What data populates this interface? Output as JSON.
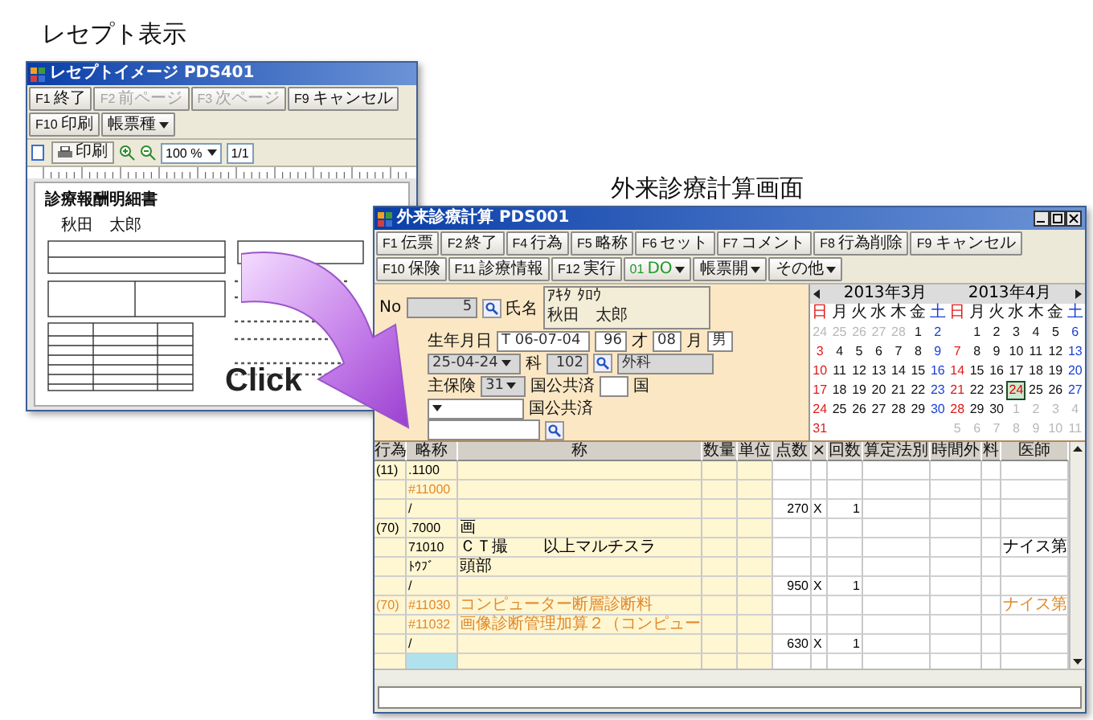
{
  "left_caption": "レセプト表示",
  "right_caption": "外来診療計算画面",
  "receipt_window": {
    "title": "レセプトイメージ PDS401",
    "toolbar": [
      {
        "kind": "fkey",
        "key": "F1",
        "label": "終了",
        "disabled": false
      },
      {
        "kind": "fkey",
        "key": "F2",
        "label": "前ページ",
        "disabled": true
      },
      {
        "kind": "fkey",
        "key": "F3",
        "label": "次ページ",
        "disabled": true
      },
      {
        "kind": "fkey",
        "key": "F9",
        "label": "キャンセル",
        "disabled": false
      },
      {
        "kind": "fkey",
        "key": "F10",
        "label": "印刷",
        "disabled": false
      },
      {
        "kind": "dropdown",
        "label": "帳票種",
        "disabled": false
      }
    ],
    "print_button": "印刷",
    "zoom": "100 %",
    "page": "1/1",
    "document": {
      "title": "診療報酬明細書",
      "patient": "秋田　太郎"
    }
  },
  "click_label": "Click",
  "calc_window": {
    "title": "外来診療計算 PDS001",
    "toolbar": [
      {
        "kind": "fkey",
        "key": "F1",
        "label": "伝票"
      },
      {
        "kind": "fkey",
        "key": "F2",
        "label": "終了"
      },
      {
        "kind": "fkey",
        "key": "F4",
        "label": "行為"
      },
      {
        "kind": "fkey",
        "key": "F5",
        "label": "略称"
      },
      {
        "kind": "fkey",
        "key": "F6",
        "label": "セット"
      },
      {
        "kind": "fkey",
        "key": "F7",
        "label": "コメント"
      },
      {
        "kind": "fkey",
        "key": "F8",
        "label": "行為削除"
      },
      {
        "kind": "fkey",
        "key": "F9",
        "label": "キャンセル"
      },
      {
        "kind": "fkey",
        "key": "F10",
        "label": "保険"
      },
      {
        "kind": "fkey",
        "key": "F11",
        "label": "診療情報"
      },
      {
        "kind": "fkey",
        "key": "F12",
        "label": "実行"
      },
      {
        "kind": "do",
        "key": "01",
        "label": "DO"
      },
      {
        "kind": "dropdown",
        "label": "帳票開"
      },
      {
        "kind": "dropdown",
        "label": "その他"
      }
    ],
    "form": {
      "no_label": "No",
      "no_value": "5",
      "name_label": "氏名",
      "kana": "ｱｷﾀ ﾀﾛｳ",
      "name": "秋田　太郎",
      "birth_label": "生年月日",
      "birth": "T 06-07-04",
      "age": "96",
      "age_unit": "才",
      "months": "08",
      "months_unit": "月",
      "sex": "男",
      "visit_date": "25-04-24",
      "dept_label": "科",
      "dept_code": "102",
      "dept_name": "外科",
      "insurance_label": "主保険",
      "insurance_code": "31",
      "insurance_name": "国公共済",
      "insurance_flag": "国",
      "public_name": "国公共済"
    },
    "calendar": {
      "months": [
        {
          "title": "2013年3月",
          "weekdays": [
            "日",
            "月",
            "火",
            "水",
            "木",
            "金",
            "土"
          ],
          "days": [
            {
              "kind": "day",
              "d": "24",
              "muted": true,
              "selected": false
            },
            {
              "kind": "day",
              "d": "25",
              "muted": true,
              "selected": false
            },
            {
              "kind": "day",
              "d": "26",
              "muted": true,
              "selected": false
            },
            {
              "kind": "day",
              "d": "27",
              "muted": true,
              "selected": false
            },
            {
              "kind": "day",
              "d": "28",
              "muted": true,
              "selected": false
            },
            {
              "kind": "day",
              "d": "1",
              "muted": false,
              "selected": false
            },
            {
              "kind": "day",
              "d": "2",
              "muted": false,
              "selected": false
            },
            {
              "kind": "day",
              "d": "3",
              "muted": false,
              "selected": false
            },
            {
              "kind": "day",
              "d": "4",
              "muted": false,
              "selected": false
            },
            {
              "kind": "day",
              "d": "5",
              "muted": false,
              "selected": false
            },
            {
              "kind": "day",
              "d": "6",
              "muted": false,
              "selected": false
            },
            {
              "kind": "day",
              "d": "7",
              "muted": false,
              "selected": false
            },
            {
              "kind": "day",
              "d": "8",
              "muted": false,
              "selected": false
            },
            {
              "kind": "day",
              "d": "9",
              "muted": false,
              "selected": false
            },
            {
              "kind": "day",
              "d": "10",
              "muted": false,
              "selected": false
            },
            {
              "kind": "day",
              "d": "11",
              "muted": false,
              "selected": false
            },
            {
              "kind": "day",
              "d": "12",
              "muted": false,
              "selected": false
            },
            {
              "kind": "day",
              "d": "13",
              "muted": false,
              "selected": false
            },
            {
              "kind": "day",
              "d": "14",
              "muted": false,
              "selected": false
            },
            {
              "kind": "day",
              "d": "15",
              "muted": false,
              "selected": false
            },
            {
              "kind": "day",
              "d": "16",
              "muted": false,
              "selected": false
            },
            {
              "kind": "day",
              "d": "17",
              "muted": false,
              "selected": false
            },
            {
              "kind": "day",
              "d": "18",
              "muted": false,
              "selected": false
            },
            {
              "kind": "day",
              "d": "19",
              "muted": false,
              "selected": false
            },
            {
              "kind": "day",
              "d": "20",
              "muted": false,
              "selected": false
            },
            {
              "kind": "day",
              "d": "21",
              "muted": false,
              "selected": false
            },
            {
              "kind": "day",
              "d": "22",
              "muted": false,
              "selected": false
            },
            {
              "kind": "day",
              "d": "23",
              "muted": false,
              "selected": false
            },
            {
              "kind": "day",
              "d": "24",
              "muted": false,
              "selected": false
            },
            {
              "kind": "day",
              "d": "25",
              "muted": false,
              "selected": false
            },
            {
              "kind": "day",
              "d": "26",
              "muted": false,
              "selected": false
            },
            {
              "kind": "day",
              "d": "27",
              "muted": false,
              "selected": false
            },
            {
              "kind": "day",
              "d": "28",
              "muted": false,
              "selected": false
            },
            {
              "kind": "day",
              "d": "29",
              "muted": false,
              "selected": false
            },
            {
              "kind": "day",
              "d": "30",
              "muted": false,
              "selected": false
            },
            {
              "kind": "day",
              "d": "31",
              "muted": false,
              "selected": false
            }
          ]
        },
        {
          "title": "2013年4月",
          "weekdays": [
            "日",
            "月",
            "火",
            "水",
            "木",
            "金",
            "土"
          ],
          "days": [
            {
              "kind": "blank"
            },
            {
              "kind": "day",
              "d": "1",
              "muted": false,
              "selected": false
            },
            {
              "kind": "day",
              "d": "2",
              "muted": false,
              "selected": false
            },
            {
              "kind": "day",
              "d": "3",
              "muted": false,
              "selected": false
            },
            {
              "kind": "day",
              "d": "4",
              "muted": false,
              "selected": false
            },
            {
              "kind": "day",
              "d": "5",
              "muted": false,
              "selected": false
            },
            {
              "kind": "day",
              "d": "6",
              "muted": false,
              "selected": false
            },
            {
              "kind": "day",
              "d": "7",
              "muted": false,
              "selected": false
            },
            {
              "kind": "day",
              "d": "8",
              "muted": false,
              "selected": false
            },
            {
              "kind": "day",
              "d": "9",
              "muted": false,
              "selected": false
            },
            {
              "kind": "day",
              "d": "10",
              "muted": false,
              "selected": false
            },
            {
              "kind": "day",
              "d": "11",
              "muted": false,
              "selected": false
            },
            {
              "kind": "day",
              "d": "12",
              "muted": false,
              "selected": false
            },
            {
              "kind": "day",
              "d": "13",
              "muted": false,
              "selected": false
            },
            {
              "kind": "day",
              "d": "14",
              "muted": false,
              "selected": false
            },
            {
              "kind": "day",
              "d": "15",
              "muted": false,
              "selected": false
            },
            {
              "kind": "day",
              "d": "16",
              "muted": false,
              "selected": false
            },
            {
              "kind": "day",
              "d": "17",
              "muted": false,
              "selected": false
            },
            {
              "kind": "day",
              "d": "18",
              "muted": false,
              "selected": false
            },
            {
              "kind": "day",
              "d": "19",
              "muted": false,
              "selected": false
            },
            {
              "kind": "day",
              "d": "20",
              "muted": false,
              "selected": false
            },
            {
              "kind": "day",
              "d": "21",
              "muted": false,
              "selected": false
            },
            {
              "kind": "day",
              "d": "22",
              "muted": false,
              "selected": false
            },
            {
              "kind": "day",
              "d": "23",
              "muted": false,
              "selected": false
            },
            {
              "kind": "day",
              "d": "24",
              "muted": false,
              "selected": true
            },
            {
              "kind": "day",
              "d": "25",
              "muted": false,
              "selected": false
            },
            {
              "kind": "day",
              "d": "26",
              "muted": false,
              "selected": false
            },
            {
              "kind": "day",
              "d": "27",
              "muted": false,
              "selected": false
            },
            {
              "kind": "day",
              "d": "28",
              "muted": false,
              "selected": false
            },
            {
              "kind": "day",
              "d": "29",
              "muted": false,
              "selected": false
            },
            {
              "kind": "day",
              "d": "30",
              "muted": false,
              "selected": false
            },
            {
              "kind": "day",
              "d": "1",
              "muted": true,
              "selected": false
            },
            {
              "kind": "day",
              "d": "2",
              "muted": true,
              "selected": false
            },
            {
              "kind": "day",
              "d": "3",
              "muted": true,
              "selected": false
            },
            {
              "kind": "day",
              "d": "4",
              "muted": true,
              "selected": false
            },
            {
              "kind": "day",
              "d": "5",
              "muted": true,
              "selected": false
            },
            {
              "kind": "day",
              "d": "6",
              "muted": true,
              "selected": false
            },
            {
              "kind": "day",
              "d": "7",
              "muted": true,
              "selected": false
            },
            {
              "kind": "day",
              "d": "8",
              "muted": true,
              "selected": false
            },
            {
              "kind": "day",
              "d": "9",
              "muted": true,
              "selected": false
            },
            {
              "kind": "day",
              "d": "10",
              "muted": true,
              "selected": false
            },
            {
              "kind": "day",
              "d": "11",
              "muted": true,
              "selected": false
            }
          ]
        }
      ]
    },
    "grid": {
      "columns": [
        "行為",
        "略称",
        "称",
        "数量",
        "単位",
        "点数",
        "×",
        "回数",
        "算定法別",
        "時間外",
        "料",
        "医師"
      ],
      "rows": [
        {
          "act": "(11)",
          "abbr": ".1100",
          "color": "#000000",
          "selected": false
        },
        {
          "abbr": "#11000",
          "color": "#e08a2c",
          "selected": false
        },
        {
          "abbr": "/",
          "points": "270",
          "times": "X",
          "count": "1",
          "color": "#000000",
          "selected": false
        },
        {
          "act": "(70)",
          "abbr": ".7000",
          "name": "画",
          "color": "#000000",
          "selected": false
        },
        {
          "abbr": "71010",
          "name": "ＣＴ撮",
          "name_tail": "以上マルチスラ",
          "doctor": "ナイス第",
          "color": "#000000",
          "selected": false
        },
        {
          "abbr": "ﾄｳﾌﾞ",
          "name": "頭部",
          "color": "#000000",
          "selected": false
        },
        {
          "abbr": "/",
          "points": "950",
          "times": "X",
          "count": "1",
          "color": "#000000",
          "selected": false
        },
        {
          "act": "(70)",
          "abbr": "#11030",
          "name": "コンピューター断層診断料",
          "doctor": "ナイス第",
          "color": "#e08a2c",
          "selected": false
        },
        {
          "abbr": "#11032",
          "name": "画像診断管理加算２（コンピュー",
          "color": "#e08a2c",
          "selected": false
        },
        {
          "abbr": "/",
          "points": "630",
          "times": "X",
          "count": "1",
          "color": "#000000",
          "selected": false
        },
        {
          "selected": true
        }
      ]
    }
  }
}
